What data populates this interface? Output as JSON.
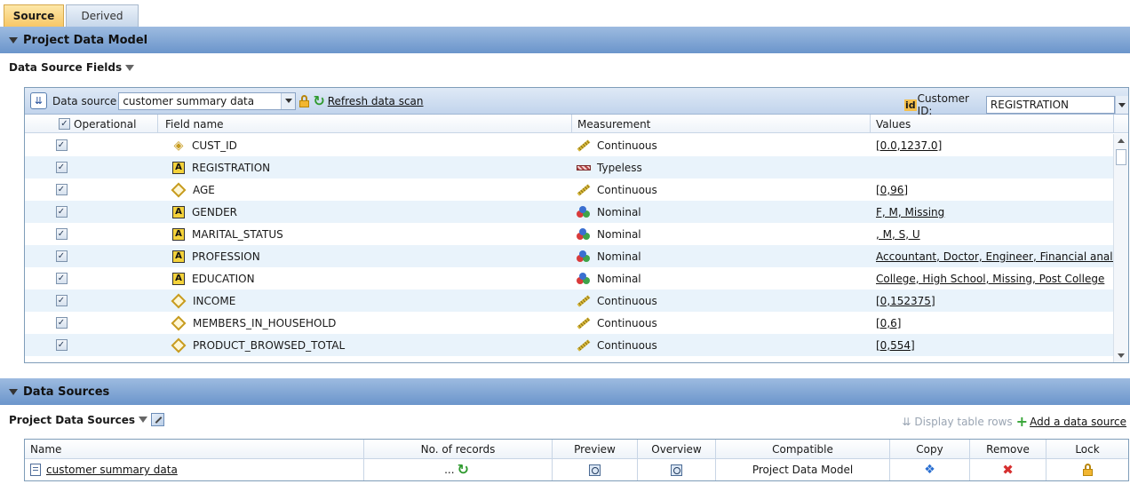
{
  "tabs": [
    {
      "label": "Source",
      "active": true
    },
    {
      "label": "Derived",
      "active": false
    }
  ],
  "sections": {
    "project_data_model": "Project Data Model",
    "data_sources": "Data Sources"
  },
  "data_source_fields": {
    "heading": "Data Source Fields",
    "toolbar": {
      "data_source_label": "Data source",
      "data_source_value": "customer summary data",
      "refresh_label": "Refresh data scan",
      "customer_id_badge": "id",
      "customer_id_label": "Customer ID:",
      "customer_id_value": "REGISTRATION"
    },
    "columns": {
      "operational": "Operational",
      "field_name": "Field name",
      "measurement": "Measurement",
      "values": "Values"
    },
    "rows": [
      {
        "checked": true,
        "type_icon": "key-icon",
        "name": "CUST_ID",
        "measure_icon": "continuous-icon",
        "measurement": "Continuous",
        "values": "[0.0,1237.0]"
      },
      {
        "checked": true,
        "type_icon": "string-icon",
        "name": "REGISTRATION",
        "measure_icon": "typeless-icon",
        "measurement": "Typeless",
        "values": ""
      },
      {
        "checked": true,
        "type_icon": "numeric-icon",
        "name": "AGE",
        "measure_icon": "continuous-icon",
        "measurement": "Continuous",
        "values": "[0,96]"
      },
      {
        "checked": true,
        "type_icon": "string-icon",
        "name": "GENDER",
        "measure_icon": "nominal-icon",
        "measurement": "Nominal",
        "values": "F, M, Missing"
      },
      {
        "checked": true,
        "type_icon": "string-icon",
        "name": "MARITAL_STATUS",
        "measure_icon": "nominal-icon",
        "measurement": "Nominal",
        "values": ", M, S, U"
      },
      {
        "checked": true,
        "type_icon": "string-icon",
        "name": "PROFESSION",
        "measure_icon": "nominal-icon",
        "measurement": "Nominal",
        "values": "Accountant, Doctor, Engineer, Financial analy"
      },
      {
        "checked": true,
        "type_icon": "string-icon",
        "name": "EDUCATION",
        "measure_icon": "nominal-icon",
        "measurement": "Nominal",
        "values": "College, High School, Missing, Post College"
      },
      {
        "checked": true,
        "type_icon": "numeric-icon",
        "name": "INCOME",
        "measure_icon": "continuous-icon",
        "measurement": "Continuous",
        "values": "[0,152375]"
      },
      {
        "checked": true,
        "type_icon": "numeric-icon",
        "name": "MEMBERS_IN_HOUSEHOLD",
        "measure_icon": "continuous-icon",
        "measurement": "Continuous",
        "values": "[0,6]"
      },
      {
        "checked": true,
        "type_icon": "numeric-icon",
        "name": "PRODUCT_BROWSED_TOTAL",
        "measure_icon": "continuous-icon",
        "measurement": "Continuous",
        "values": "[0,554]"
      }
    ]
  },
  "project_data_sources": {
    "heading": "Project Data Sources",
    "display_table_rows": "Display table rows",
    "add_data_source": "Add a data source",
    "columns": {
      "name": "Name",
      "records": "No. of records",
      "preview": "Preview",
      "overview": "Overview",
      "compatible": "Compatible",
      "copy": "Copy",
      "remove": "Remove",
      "lock": "Lock"
    },
    "rows": [
      {
        "name": "customer summary data",
        "records": "...",
        "compatible": "Project Data Model"
      }
    ]
  },
  "colors": {
    "section_bar": "#7fa3d4",
    "active_tab": "#f7c766",
    "alt_row": "#e9f3fb"
  }
}
